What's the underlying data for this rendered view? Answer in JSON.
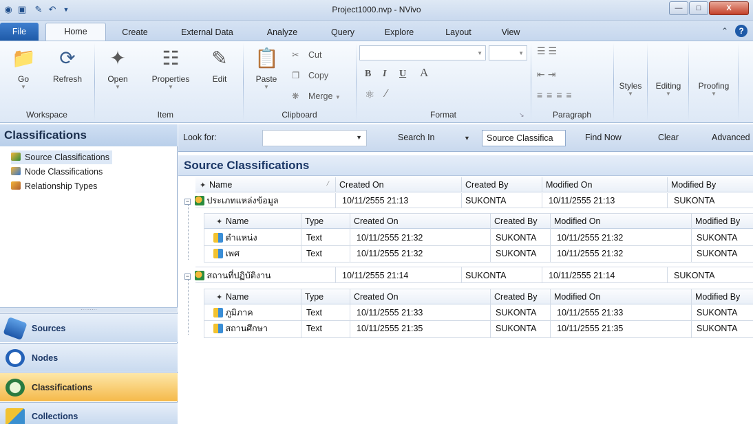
{
  "window": {
    "title": "Project1000.nvp - NVivo",
    "controls": {
      "minimize": "—",
      "maximize": "□",
      "close": "X"
    }
  },
  "menu_tabs": [
    "File",
    "Home",
    "Create",
    "External Data",
    "Analyze",
    "Query",
    "Explore",
    "Layout",
    "View"
  ],
  "ribbon": {
    "workspace": {
      "label": "Workspace",
      "go": "Go",
      "refresh": "Refresh"
    },
    "item": {
      "label": "Item",
      "open": "Open",
      "properties": "Properties",
      "edit": "Edit"
    },
    "clipboard": {
      "label": "Clipboard",
      "paste": "Paste",
      "cut": "Cut",
      "copy": "Copy",
      "merge": "Merge"
    },
    "format": {
      "label": "Format",
      "bold": "B",
      "italic": "I",
      "underline": "U",
      "fontcolor": "A"
    },
    "paragraph": {
      "label": "Paragraph"
    },
    "styles": "Styles",
    "editing": "Editing",
    "proofing": "Proofing"
  },
  "left_panel": {
    "title": "Classifications",
    "items": [
      "Source Classifications",
      "Node Classifications",
      "Relationship Types"
    ],
    "nav": [
      "Sources",
      "Nodes",
      "Classifications",
      "Collections"
    ]
  },
  "search_bar": {
    "look_for": "Look for:",
    "search_in": "Search In",
    "scope": "Source Classifica",
    "find_now": "Find Now",
    "clear": "Clear",
    "advanced": "Advanced"
  },
  "content": {
    "title": "Source Classifications",
    "columns": [
      "Name",
      "Created On",
      "Created By",
      "Modified On",
      "Modified By"
    ],
    "sub_columns": [
      "Name",
      "Type",
      "Created On",
      "Created By",
      "Modified On",
      "Modified By"
    ],
    "groups": [
      {
        "name": "ประเภทแหล่งข้อมูล",
        "created_on": "10/11/2555 21:13",
        "created_by": "SUKONTA",
        "modified_on": "10/11/2555 21:13",
        "modified_by": "SUKONTA",
        "attributes": [
          {
            "name": "ตำแหน่ง",
            "type": "Text",
            "created_on": "10/11/2555 21:32",
            "created_by": "SUKONTA",
            "modified_on": "10/11/2555 21:32",
            "modified_by": "SUKONTA"
          },
          {
            "name": "เพศ",
            "type": "Text",
            "created_on": "10/11/2555 21:32",
            "created_by": "SUKONTA",
            "modified_on": "10/11/2555 21:32",
            "modified_by": "SUKONTA"
          }
        ]
      },
      {
        "name": "สถานที่ปฏิบัติงาน",
        "created_on": "10/11/2555 21:14",
        "created_by": "SUKONTA",
        "modified_on": "10/11/2555 21:14",
        "modified_by": "SUKONTA",
        "attributes": [
          {
            "name": "ภูมิภาค",
            "type": "Text",
            "created_on": "10/11/2555 21:33",
            "created_by": "SUKONTA",
            "modified_on": "10/11/2555 21:33",
            "modified_by": "SUKONTA"
          },
          {
            "name": "สถานศึกษา",
            "type": "Text",
            "created_on": "10/11/2555 21:35",
            "created_by": "SUKONTA",
            "modified_on": "10/11/2555 21:35",
            "modified_by": "SUKONTA"
          }
        ]
      }
    ]
  },
  "colors": {
    "accent": "#1e5aa8",
    "nav_selected": "#f5b94a",
    "header_text": "#1b3766"
  }
}
